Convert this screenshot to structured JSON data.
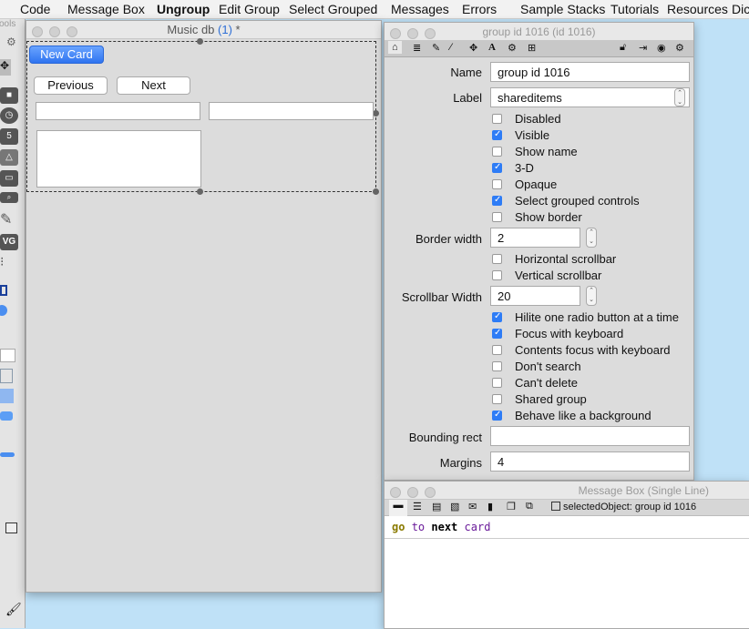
{
  "menubar": {
    "items": [
      "Code",
      "Message Box",
      "Ungroup",
      "Edit Group",
      "Select Grouped",
      "Messages",
      "Errors",
      "Sample Stacks",
      "Tutorials",
      "Resources",
      "Dic"
    ]
  },
  "tools": {
    "title": "Tools"
  },
  "stack": {
    "title": "Music db",
    "card_num": "(1)",
    "dirty": " *",
    "new_card": "New Card",
    "previous": "Previous",
    "next": "Next"
  },
  "inspector": {
    "title": "group id 1016 (id 1016)",
    "name_label": "Name",
    "name_value": "group id 1016",
    "label_label": "Label",
    "label_value": "shareditems",
    "checks1": [
      {
        "label": "Disabled",
        "checked": false
      },
      {
        "label": "Visible",
        "checked": true
      },
      {
        "label": "Show name",
        "checked": false
      },
      {
        "label": "3-D",
        "checked": true
      },
      {
        "label": "Opaque",
        "checked": false
      },
      {
        "label": "Select grouped controls",
        "checked": true
      },
      {
        "label": "Show border",
        "checked": false
      }
    ],
    "border_width_label": "Border width",
    "border_width": "2",
    "checks2": [
      {
        "label": "Horizontal scrollbar",
        "checked": false
      },
      {
        "label": "Vertical scrollbar",
        "checked": false
      }
    ],
    "scrollbar_width_label": "Scrollbar Width",
    "scrollbar_width": "20",
    "checks3": [
      {
        "label": "Hilite one radio button at a time",
        "checked": true
      },
      {
        "label": "Focus with keyboard",
        "checked": true
      },
      {
        "label": "Contents focus with keyboard",
        "checked": false
      },
      {
        "label": "Don't search",
        "checked": false
      },
      {
        "label": "Can't delete",
        "checked": false
      },
      {
        "label": "Shared group",
        "checked": false
      },
      {
        "label": "Behave like a background",
        "checked": true
      }
    ],
    "bounding_label": "Bounding rect",
    "bounding_value": "",
    "margins_label": "Margins",
    "margins_value": "4"
  },
  "msgbox": {
    "title": "Message Box (Single Line)",
    "selected": "selectedObject: group id 1016",
    "code": [
      "go",
      "to",
      "next",
      "card"
    ],
    "colors": {
      "go": "#8a7a00",
      "to": "#6a1b9a",
      "next": "#000000",
      "card": "#6a1b9a"
    }
  }
}
